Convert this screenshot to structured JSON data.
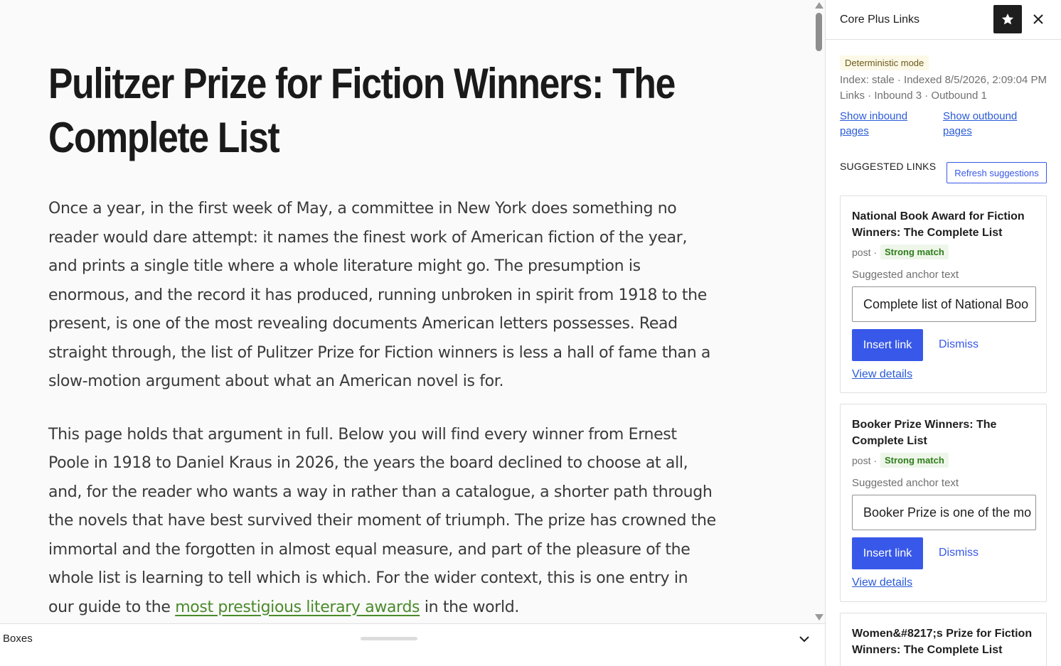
{
  "editor": {
    "title": "Pulitzer Prize for Fiction Winners: The Complete List",
    "paragraph1": "Once a year, in the first week of May, a committee in New York does something no reader would dare attempt: it names the finest work of American fiction of the year, and prints a single title where a whole literature might go. The presumption is enormous, and the record it has produced, running unbroken in spirit from 1918 to the present, is one of the most revealing documents American letters possesses. Read straight through, the list of Pulitzer Prize for Fiction winners is less a hall of fame than a slow-motion argument about what an American novel is for.",
    "paragraph2_before": "This page holds that argument in full. Below you will find every winner from Ernest Poole in 1918 to Daniel Kraus in 2026, the years the board declined to choose at all, and, for the reader who wants a way in rather than a catalogue, a shorter path through the novels that have best survived their moment of triumph. The prize has crowned the immortal and the forgotten in almost equal measure, and part of the pleasure of the whole list is learning to tell which is which. For the wider context, this is one entry in our guide to the ",
    "paragraph2_link": "most prestigious literary awards",
    "paragraph2_after": " in the world."
  },
  "bottombar": {
    "label": "Boxes"
  },
  "sidebar": {
    "title": "Core Plus Links",
    "mode_badge": "Deterministic mode",
    "index_status": "Index: stale · Indexed 8/5/2026, 2:09:04 PM",
    "links_count": "Links · Inbound 3 · Outbound 1",
    "show_inbound": "Show inbound pages",
    "show_outbound": "Show outbound pages",
    "suggested_heading": "SUGGESTED LINKS",
    "refresh_label": "Refresh suggestions",
    "anchor_label": "Suggested anchor text",
    "insert_label": "Insert link",
    "dismiss_label": "Dismiss",
    "details_label": "View details",
    "suggestions": [
      {
        "title": "National Book Award for Fiction Winners: The Complete List",
        "type": "post ·",
        "strength": "Strong match",
        "anchor": "Complete list of National Boo"
      },
      {
        "title": "Booker Prize Winners: The Complete List",
        "type": "post ·",
        "strength": "Strong match",
        "anchor": "Booker Prize is one of the mo"
      },
      {
        "title": "Women&#8217;s Prize for Fiction Winners: The Complete List"
      }
    ]
  }
}
